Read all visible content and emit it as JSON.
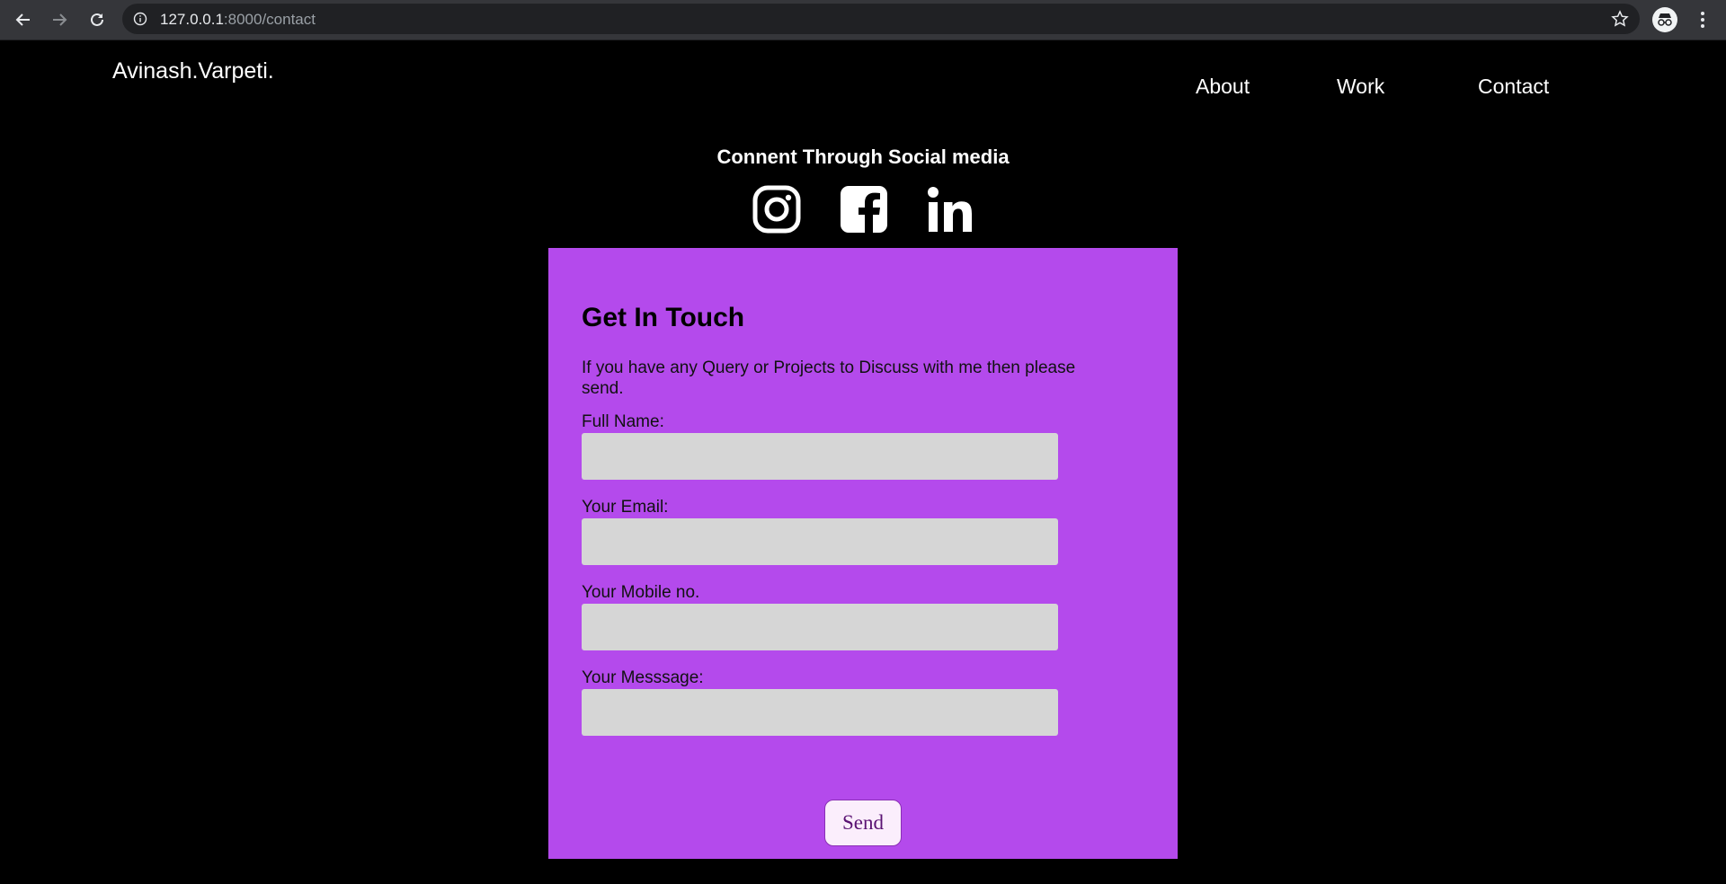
{
  "browser": {
    "url_host": "127.0.0.1",
    "url_path": ":8000/contact"
  },
  "header": {
    "brand": "Avinash.Varpeti.",
    "nav": [
      "About",
      "Work",
      "Contact"
    ]
  },
  "social": {
    "title": "Connent Through Social media",
    "icons": [
      "instagram-icon",
      "facebook-icon",
      "linkedin-icon"
    ]
  },
  "contact_form": {
    "title": "Get In Touch",
    "intro": "If you have any Query or Projects to Discuss with me then please send.",
    "fields": [
      {
        "label": "Full Name:",
        "value": ""
      },
      {
        "label": "Your Email:",
        "value": ""
      },
      {
        "label": "Your Mobile no.",
        "value": ""
      },
      {
        "label": "Your Messsage:",
        "value": ""
      }
    ],
    "submit_label": "Send"
  },
  "colors": {
    "page_background": "#000000",
    "card_background": "#b44aec",
    "input_background": "#d6d6d6"
  }
}
